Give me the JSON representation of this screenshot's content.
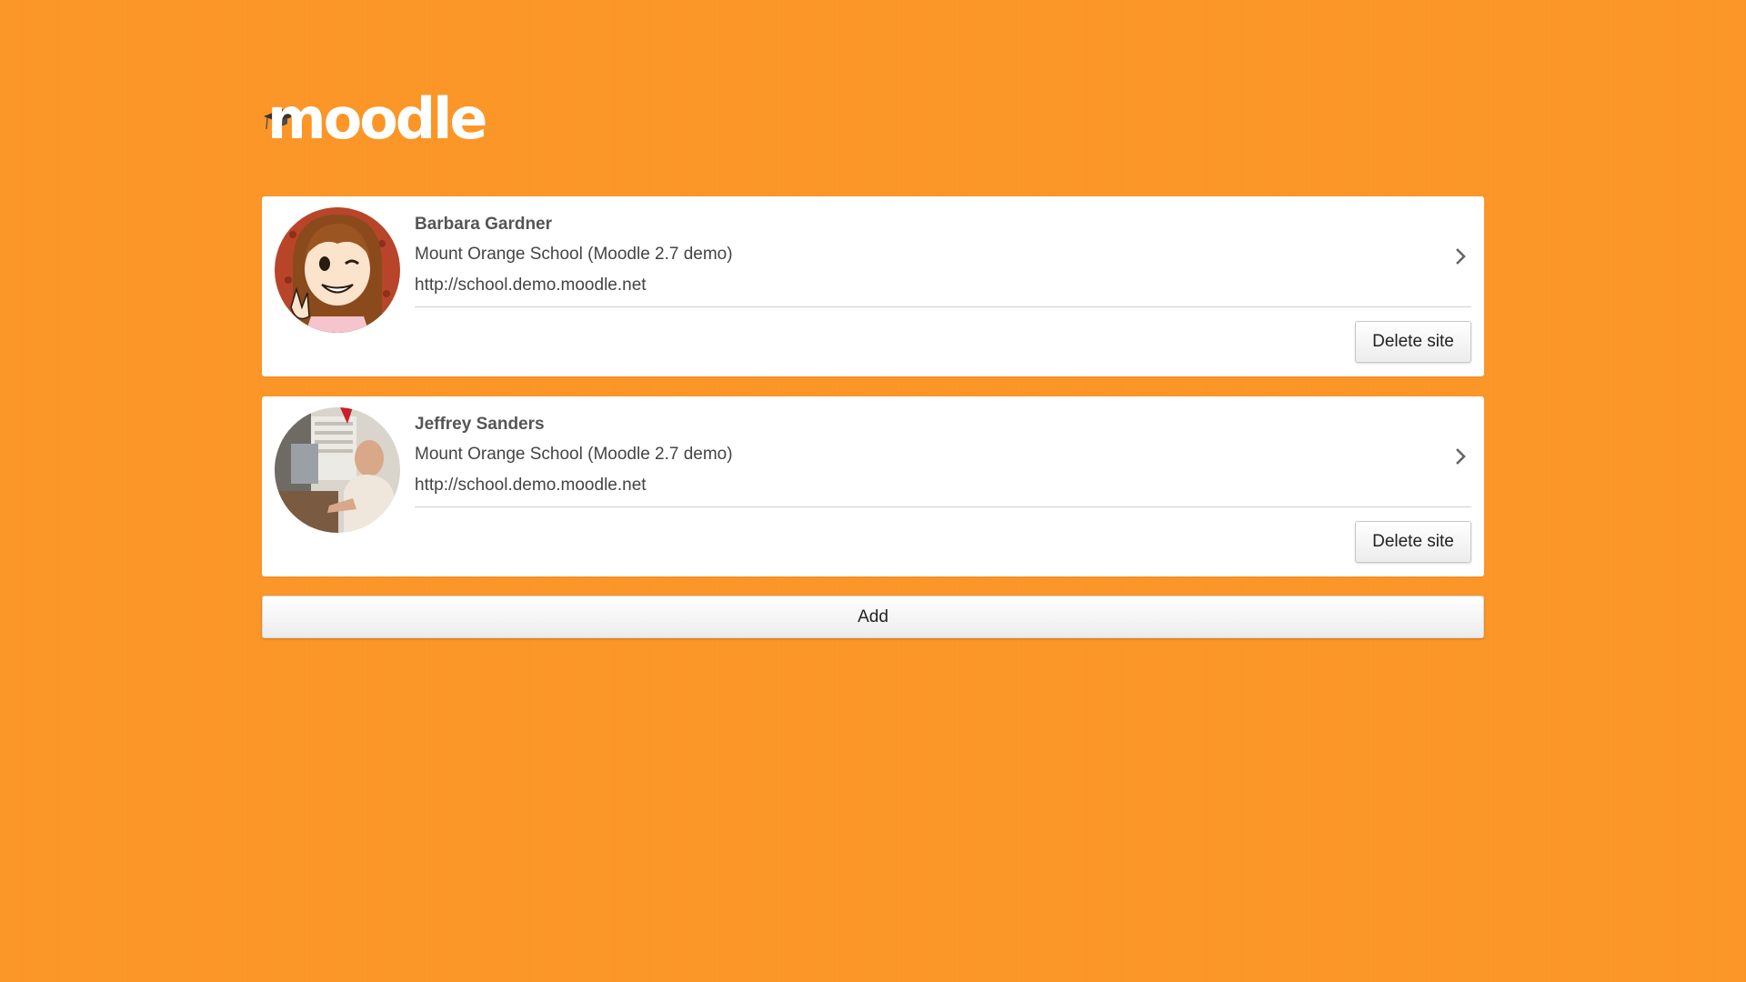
{
  "app": {
    "logo_text": "moodle"
  },
  "sites": [
    {
      "user_name": "Barbara Gardner",
      "site_name": "Mount Orange School (Moodle 2.7 demo)",
      "site_url": "http://school.demo.moodle.net",
      "delete_label": "Delete site",
      "avatar_icon": "cartoon-girl-avatar"
    },
    {
      "user_name": "Jeffrey Sanders",
      "site_name": "Mount Orange School (Moodle 2.7 demo)",
      "site_url": "http://school.demo.moodle.net",
      "delete_label": "Delete site",
      "avatar_icon": "man-photo-avatar"
    }
  ],
  "actions": {
    "add_label": "Add"
  },
  "colors": {
    "background": "#fb9526",
    "card": "#ffffff",
    "text": "#444444"
  }
}
